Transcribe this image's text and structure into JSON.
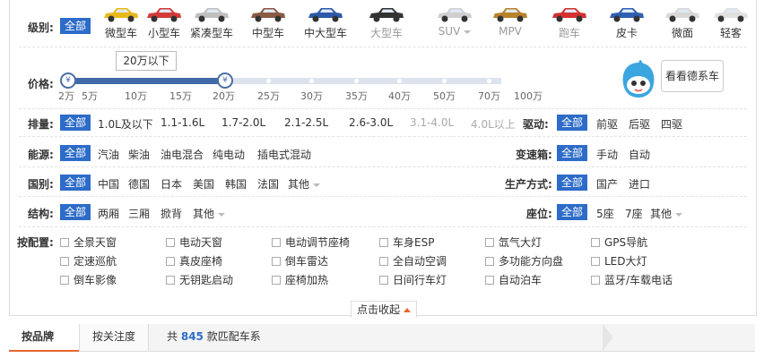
{
  "level": {
    "label": "级别:",
    "all": "全部",
    "items": [
      {
        "label": "微型车",
        "color": "#e8b91a",
        "gray": false
      },
      {
        "label": "小型车",
        "color": "#d23a3a",
        "gray": false
      },
      {
        "label": "紧凑型车",
        "color": "#bfbfbf",
        "gray": false
      },
      {
        "label": "中型车",
        "color": "#8a5a44",
        "gray": false
      },
      {
        "label": "中大型车",
        "color": "#2d5aa8",
        "gray": false
      },
      {
        "label": "大型车",
        "color": "#333333",
        "gray": true
      },
      {
        "label": "SUV",
        "color": "#cfcfcf",
        "gray": true,
        "caret": true
      },
      {
        "label": "MPV",
        "color": "#b8822a",
        "gray": true
      },
      {
        "label": "跑车",
        "color": "#d43030",
        "gray": true
      },
      {
        "label": "皮卡",
        "color": "#2f5fb0",
        "gray": false
      },
      {
        "label": "微面",
        "color": "#d8d8d8",
        "gray": false
      },
      {
        "label": "轻客",
        "color": "#e0e0e0",
        "gray": false
      }
    ]
  },
  "price": {
    "label": "价格:",
    "tooltip": "20万以下",
    "ticks": [
      "2万",
      "5万",
      "10万",
      "15万",
      "20万",
      "25万",
      "30万",
      "35万",
      "40万",
      "50万",
      "70万",
      "100万"
    ],
    "knob_min": "¥",
    "knob_max": "¥",
    "selected_min": "2万",
    "selected_max": "20万",
    "mascot_text": "看看德系车"
  },
  "displacement": {
    "label": "排量:",
    "all": "全部",
    "items": [
      {
        "label": "1.0L及以下",
        "gray": false
      },
      {
        "label": "1.1-1.6L",
        "gray": false
      },
      {
        "label": "1.7-2.0L",
        "gray": false
      },
      {
        "label": "2.1-2.5L",
        "gray": false
      },
      {
        "label": "2.6-3.0L",
        "gray": false
      },
      {
        "label": "3.1-4.0L",
        "gray": true
      },
      {
        "label": "4.0L以上",
        "gray": true
      }
    ]
  },
  "drive": {
    "label": "驱动:",
    "all": "全部",
    "items": [
      "前驱",
      "后驱",
      "四驱"
    ]
  },
  "energy": {
    "label": "能源:",
    "all": "全部",
    "items": [
      "汽油",
      "柴油",
      "油电混合",
      "纯电动",
      "插电式混动"
    ]
  },
  "gearbox": {
    "label": "变速箱:",
    "all": "全部",
    "items": [
      "手动",
      "自动"
    ]
  },
  "country": {
    "label": "国别:",
    "all": "全部",
    "items": [
      "中国",
      "德国",
      "日本",
      "美国",
      "韩国",
      "法国",
      "其他"
    ]
  },
  "production": {
    "label": "生产方式:",
    "all": "全部",
    "items": [
      "国产",
      "进口"
    ]
  },
  "structure": {
    "label": "结构:",
    "all": "全部",
    "items": [
      "两厢",
      "三厢",
      "掀背",
      "其他"
    ]
  },
  "seats": {
    "label": "座位:",
    "all": "全部",
    "items": [
      "5座",
      "7座",
      "其他"
    ]
  },
  "config": {
    "label": "按配置:",
    "items": [
      "全景天窗",
      "电动天窗",
      "电动调节座椅",
      "车身ESP",
      "氙气大灯",
      "GPS导航",
      "定速巡航",
      "真皮座椅",
      "倒车雷达",
      "全自动空调",
      "多功能方向盘",
      "LED大灯",
      "倒车影像",
      "无钥匙启动",
      "座椅加热",
      "日间行车灯",
      "自动泊车",
      "蓝牙/车载电话"
    ]
  },
  "collapse": "点击收起",
  "tabs": {
    "brand": "按品牌",
    "attention": "按关注度",
    "count_prefix": "共",
    "count": "845",
    "count_suffix": "款匹配车系"
  }
}
